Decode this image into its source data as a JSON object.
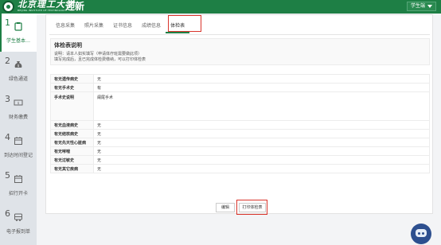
{
  "header": {
    "university_name": "北京理工大学",
    "university_en": "BEIJING INSTITUTE OF TECHNOLOGY",
    "app_title": "迎新",
    "user_label": "学生端"
  },
  "sidebar": {
    "items": [
      {
        "num": "1",
        "label": "学生基本…",
        "icon": "clipboard-icon",
        "active": true
      },
      {
        "num": "2",
        "label": "绿色通道",
        "icon": "money-bag-icon",
        "active": false
      },
      {
        "num": "3",
        "label": "财务缴费",
        "icon": "cash-icon",
        "active": false
      },
      {
        "num": "4",
        "label": "到达时间登记",
        "icon": "calendar-icon",
        "active": false
      },
      {
        "num": "5",
        "label": "招行开卡",
        "icon": "calendar-icon",
        "active": false
      },
      {
        "num": "6",
        "label": "电子报到单",
        "icon": "bus-icon",
        "active": false
      }
    ]
  },
  "tabs": [
    "信息采集",
    "照片采集",
    "证书信息",
    "成绩信息",
    "体检表"
  ],
  "active_tab": "体检表",
  "info": {
    "title": "体检表说明",
    "line1": "说明：请本人如实填写（申请体疗班需要做此项）",
    "line2": "填写完成后，且已完成体检费缴纳，可以打印体检表"
  },
  "form": {
    "rows": [
      {
        "label": "有无遗传病史",
        "value": "无"
      },
      {
        "label": "有无手术史",
        "value": "有"
      },
      {
        "label": "手术史说明",
        "value": "阑尾手术",
        "tall": true
      },
      {
        "label": "有无血液病史",
        "value": "无"
      },
      {
        "label": "有无结核病史",
        "value": "无"
      },
      {
        "label": "有无先天性心脏病",
        "value": "无"
      },
      {
        "label": "有无哮喘",
        "value": "无"
      },
      {
        "label": "有无过敏史",
        "value": "无"
      },
      {
        "label": "有无其它疾病",
        "value": "无"
      }
    ]
  },
  "buttons": {
    "edit": "编辑",
    "print": "打印体检表"
  },
  "colors": {
    "brand_green": "#1e7f45",
    "highlight_red": "#d9342b"
  }
}
